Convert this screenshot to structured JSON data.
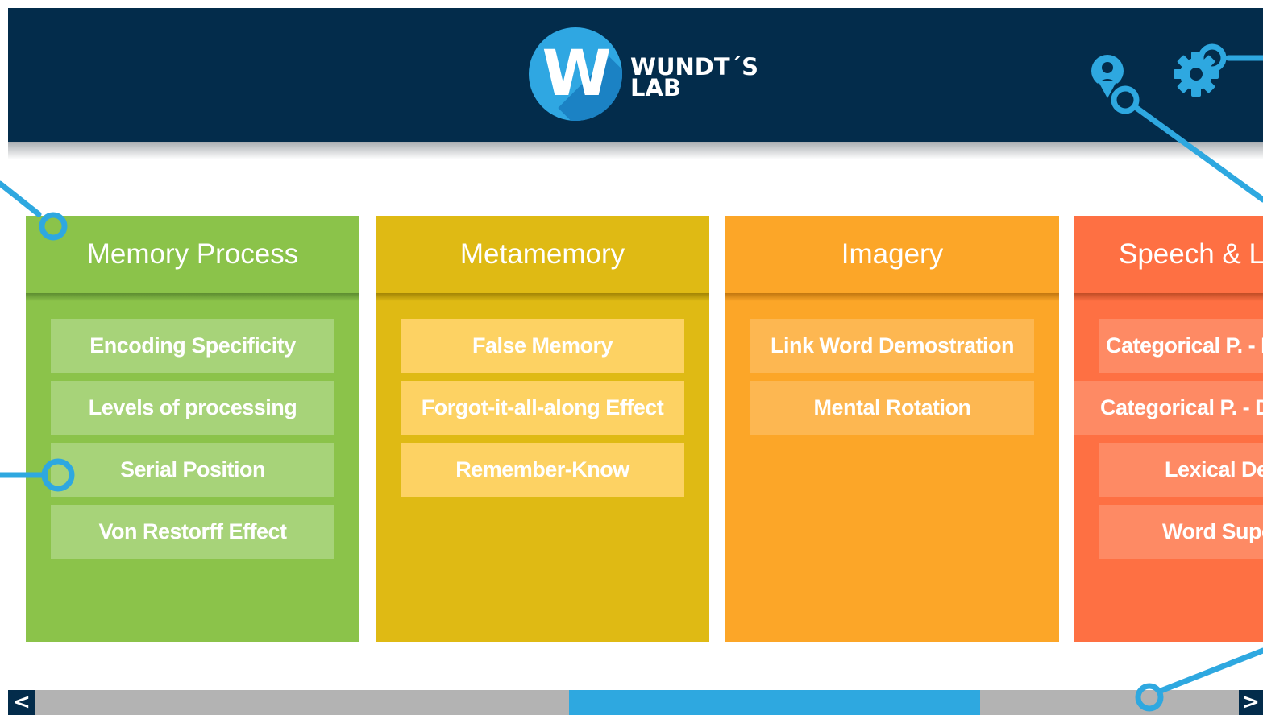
{
  "app": {
    "logo_mark": "W",
    "logo_line1": "WUNDT´S",
    "logo_line2": "LAB"
  },
  "header": {
    "icons": [
      "user-icon",
      "gear-icon"
    ]
  },
  "colors": {
    "header_bg": "#032c4b",
    "accent_blue": "#2ea8e0",
    "memory": "#8bc34a",
    "metamemory": "#dfba14",
    "imagery": "#fca628",
    "speech": "#fe7043"
  },
  "categories": [
    {
      "title": "Memory Process",
      "items": [
        "Encoding Specificity",
        "Levels of processing",
        "Serial Position",
        "Von Restorff Effect"
      ]
    },
    {
      "title": "Metamemory",
      "items": [
        "False Memory",
        "Forgot-it-all-along Effect",
        "Remember-Know"
      ]
    },
    {
      "title": "Imagery",
      "items": [
        "Link Word Demostration",
        "Mental Rotation"
      ]
    },
    {
      "title": "Speech & La",
      "items": [
        "Categorical P. - Id",
        "Categorical P. - Di",
        "Lexical Dec",
        "Word Supe"
      ]
    }
  ],
  "scrollbar": {
    "prev_label": "<",
    "next_label": ">"
  }
}
